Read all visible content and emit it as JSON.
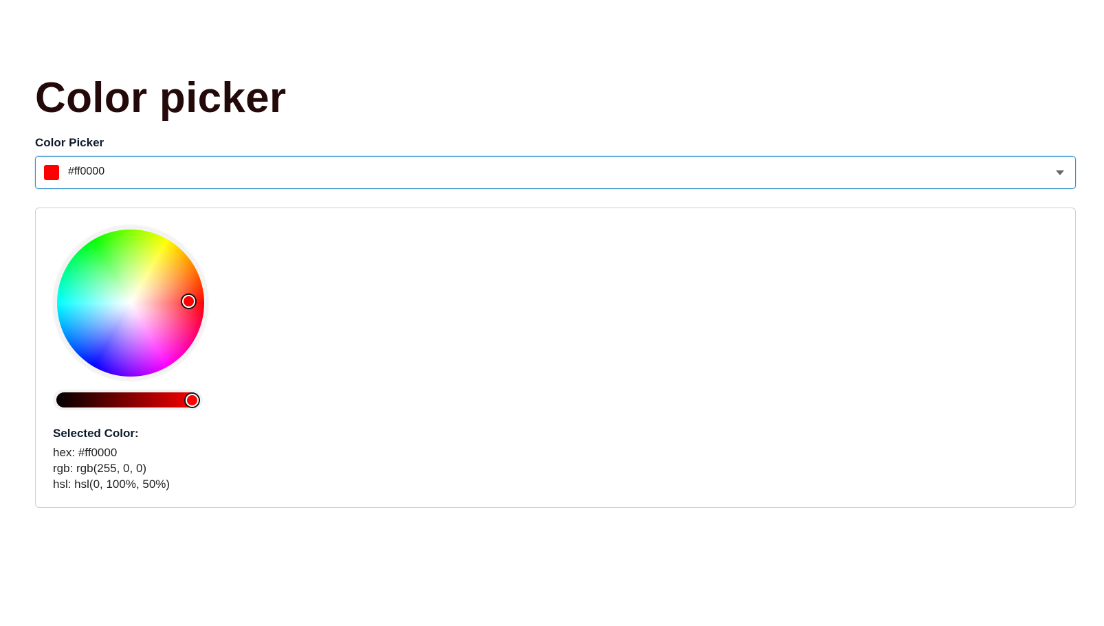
{
  "page": {
    "title": "Color picker"
  },
  "picker": {
    "label": "Color Picker",
    "value": "#ff0000",
    "swatch_color": "#ff0000",
    "dropdown_icon": "caret-down-icon"
  },
  "panel": {
    "selected_heading": "Selected Color:",
    "hex_line": "hex: #ff0000",
    "rgb_line": "rgb: rgb(255, 0, 0)",
    "hsl_line": "hsl: hsl(0, 100%, 50%)",
    "hue_degrees": 0,
    "saturation_percent": 100,
    "brightness_percent": 100,
    "handle_color": "#ff0000",
    "slider_gradient_start": "#000000",
    "slider_gradient_end": "#ff0000"
  },
  "colors": {
    "title": "#230909",
    "accent_border": "#2f8fc8",
    "panel_border": "#cfcfcf"
  }
}
